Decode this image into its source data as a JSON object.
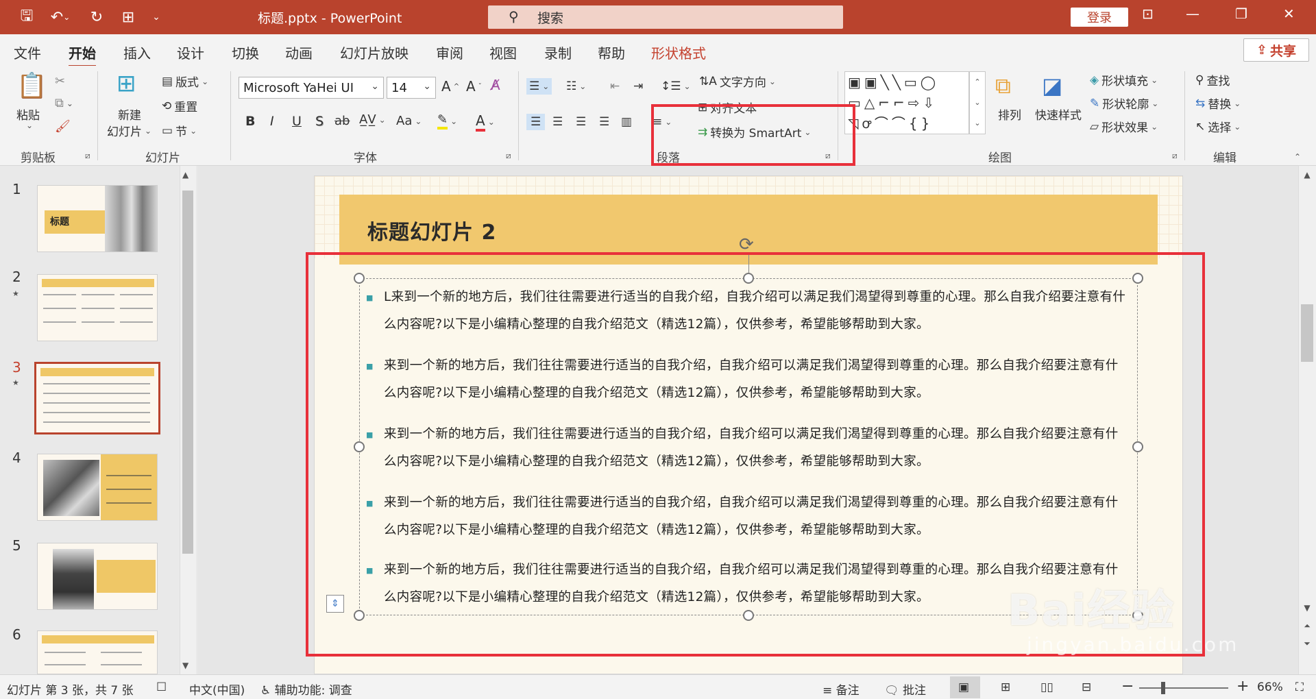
{
  "window": {
    "doc_title": "标题.pptx  -  PowerPoint",
    "search_placeholder": "搜索",
    "login_label": "登录"
  },
  "tabs": [
    "文件",
    "开始",
    "插入",
    "设计",
    "切换",
    "动画",
    "幻灯片放映",
    "审阅",
    "视图",
    "录制",
    "帮助",
    "形状格式"
  ],
  "share_label": "共享",
  "ribbon": {
    "clipboard": {
      "paste": "粘贴",
      "group": "剪贴板"
    },
    "slides": {
      "new_slide_1": "新建",
      "new_slide_2": "幻灯片",
      "layout": "版式",
      "reset": "重置",
      "section": "节",
      "group": "幻灯片"
    },
    "font": {
      "font_name": "Microsoft YaHei UI",
      "font_size": "14",
      "group": "字体",
      "bold": "B",
      "italic": "I",
      "underline": "U",
      "shadow": "S",
      "strike": "ab",
      "aa": "Aa"
    },
    "paragraph": {
      "text_direction": "文字方向",
      "align_text": "对齐文本",
      "smartart": "转换为 SmartArt",
      "group": "段落"
    },
    "drawing": {
      "arrange": "排列",
      "quick_styles": "快速样式",
      "fill": "形状填充",
      "outline": "形状轮廓",
      "effects": "形状效果",
      "group": "绘图"
    },
    "editing": {
      "find": "查找",
      "replace": "替换",
      "select": "选择",
      "group": "编辑"
    }
  },
  "thumbnails": [
    {
      "num": "1",
      "title": "标题"
    },
    {
      "num": "2",
      "title": ""
    },
    {
      "num": "3",
      "title": ""
    },
    {
      "num": "4",
      "title": ""
    },
    {
      "num": "5",
      "title": ""
    },
    {
      "num": "6",
      "title": ""
    }
  ],
  "slide": {
    "title": "标题幻灯片 2",
    "paragraphs": [
      "L来到一个新的地方后，我们往往需要进行适当的自我介绍，自我介绍可以满足我们渴望得到尊重的心理。那么自我介绍要注意有什么内容呢?以下是小编精心整理的自我介绍范文（精选12篇），仅供参考，希望能够帮助到大家。",
      "来到一个新的地方后，我们往往需要进行适当的自我介绍，自我介绍可以满足我们渴望得到尊重的心理。那么自我介绍要注意有什么内容呢?以下是小编精心整理的自我介绍范文（精选12篇），仅供参考，希望能够帮助到大家。",
      "来到一个新的地方后，我们往往需要进行适当的自我介绍，自我介绍可以满足我们渴望得到尊重的心理。那么自我介绍要注意有什么内容呢?以下是小编精心整理的自我介绍范文（精选12篇），仅供参考，希望能够帮助到大家。",
      "来到一个新的地方后，我们往往需要进行适当的自我介绍，自我介绍可以满足我们渴望得到尊重的心理。那么自我介绍要注意有什么内容呢?以下是小编精心整理的自我介绍范文（精选12篇），仅供参考，希望能够帮助到大家。",
      "来到一个新的地方后，我们往往需要进行适当的自我介绍，自我介绍可以满足我们渴望得到尊重的心理。那么自我介绍要注意有什么内容呢?以下是小编精心整理的自我介绍范文（精选12篇），仅供参考，希望能够帮助到大家。"
    ]
  },
  "status": {
    "slide_info": "幻灯片 第 3 张，共 7 张",
    "language": "中文(中国)",
    "accessibility": "辅助功能: 调查",
    "notes": "备注",
    "comments": "批注",
    "zoom": "66%"
  },
  "watermark": {
    "main": "Bai经验",
    "sub": "jingyan.baidu.com"
  },
  "colors": {
    "accent": "#b9432d",
    "highlight_box": "#e8303a",
    "title_band": "#f1c86e"
  }
}
